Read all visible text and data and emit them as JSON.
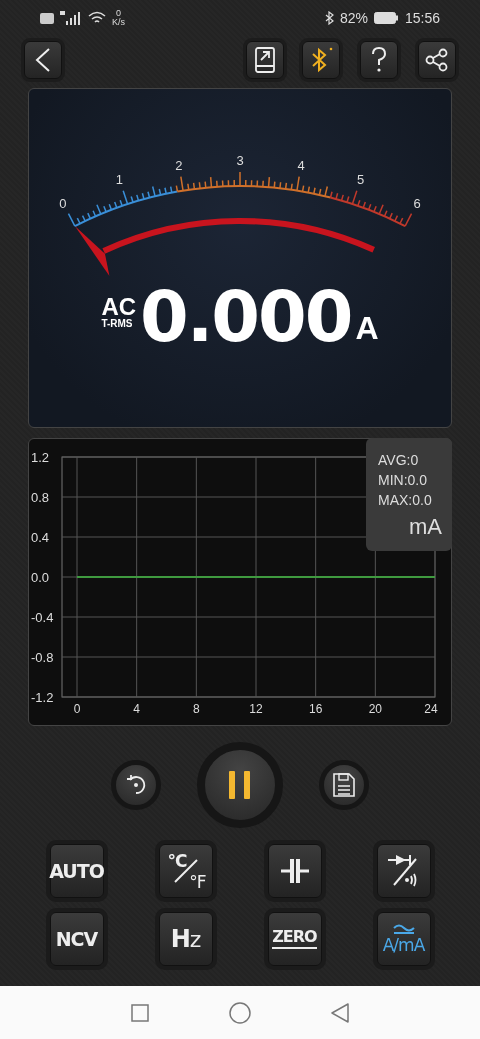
{
  "status_bar": {
    "speed_value": "0",
    "speed_unit": "K/s",
    "battery": "82%",
    "time": "15:56"
  },
  "toolbar": {
    "bluetooth_connected": false
  },
  "meter": {
    "scale_labels": [
      "0",
      "1",
      "2",
      "3",
      "4",
      "5",
      "6"
    ],
    "mode": "AC",
    "mode_detail": "T-RMS",
    "value": "0.000",
    "unit": "A"
  },
  "chart": {
    "stats": [
      "AVG:0",
      "MIN:0.0",
      "MAX:0.0"
    ],
    "unit": "mA",
    "chart_data": {
      "type": "line",
      "x": [
        0,
        24
      ],
      "grid": true,
      "series": [
        {
          "color": "#3f9a3f",
          "values": [
            0,
            0
          ]
        }
      ],
      "xlim": [
        0,
        24
      ],
      "ylim": [
        -1.2,
        1.2
      ],
      "xticks": [
        0,
        4,
        8,
        12,
        16,
        20,
        24
      ],
      "yticks": [
        {
          "value": 1.2,
          "label": "1.2"
        },
        {
          "value": 0.8,
          "label": "0.8"
        },
        {
          "value": 0.4,
          "label": "0.4"
        },
        {
          "value": 0,
          "label": "0.0"
        },
        {
          "value": -0.4,
          "label": "-0.4"
        },
        {
          "value": -0.8,
          "label": "-0.8"
        },
        {
          "value": -1.2,
          "label": "-1.2"
        }
      ]
    }
  },
  "controls": {
    "paused": false
  },
  "keys": [
    {
      "kind": "text",
      "label": "AUTO",
      "selected": false
    },
    {
      "kind": "temp",
      "label": "°C",
      "label2": "°F",
      "selected": false
    },
    {
      "kind": "capacitor",
      "selected": false
    },
    {
      "kind": "diode",
      "selected": false
    },
    {
      "kind": "text",
      "label": "NCV",
      "selected": false
    },
    {
      "kind": "hz",
      "label": "H",
      "label2": "z",
      "selected": false
    },
    {
      "kind": "zero",
      "label": "ZERO",
      "selected": false
    },
    {
      "kind": "current",
      "label": "A/mA",
      "selected": true
    }
  ]
}
